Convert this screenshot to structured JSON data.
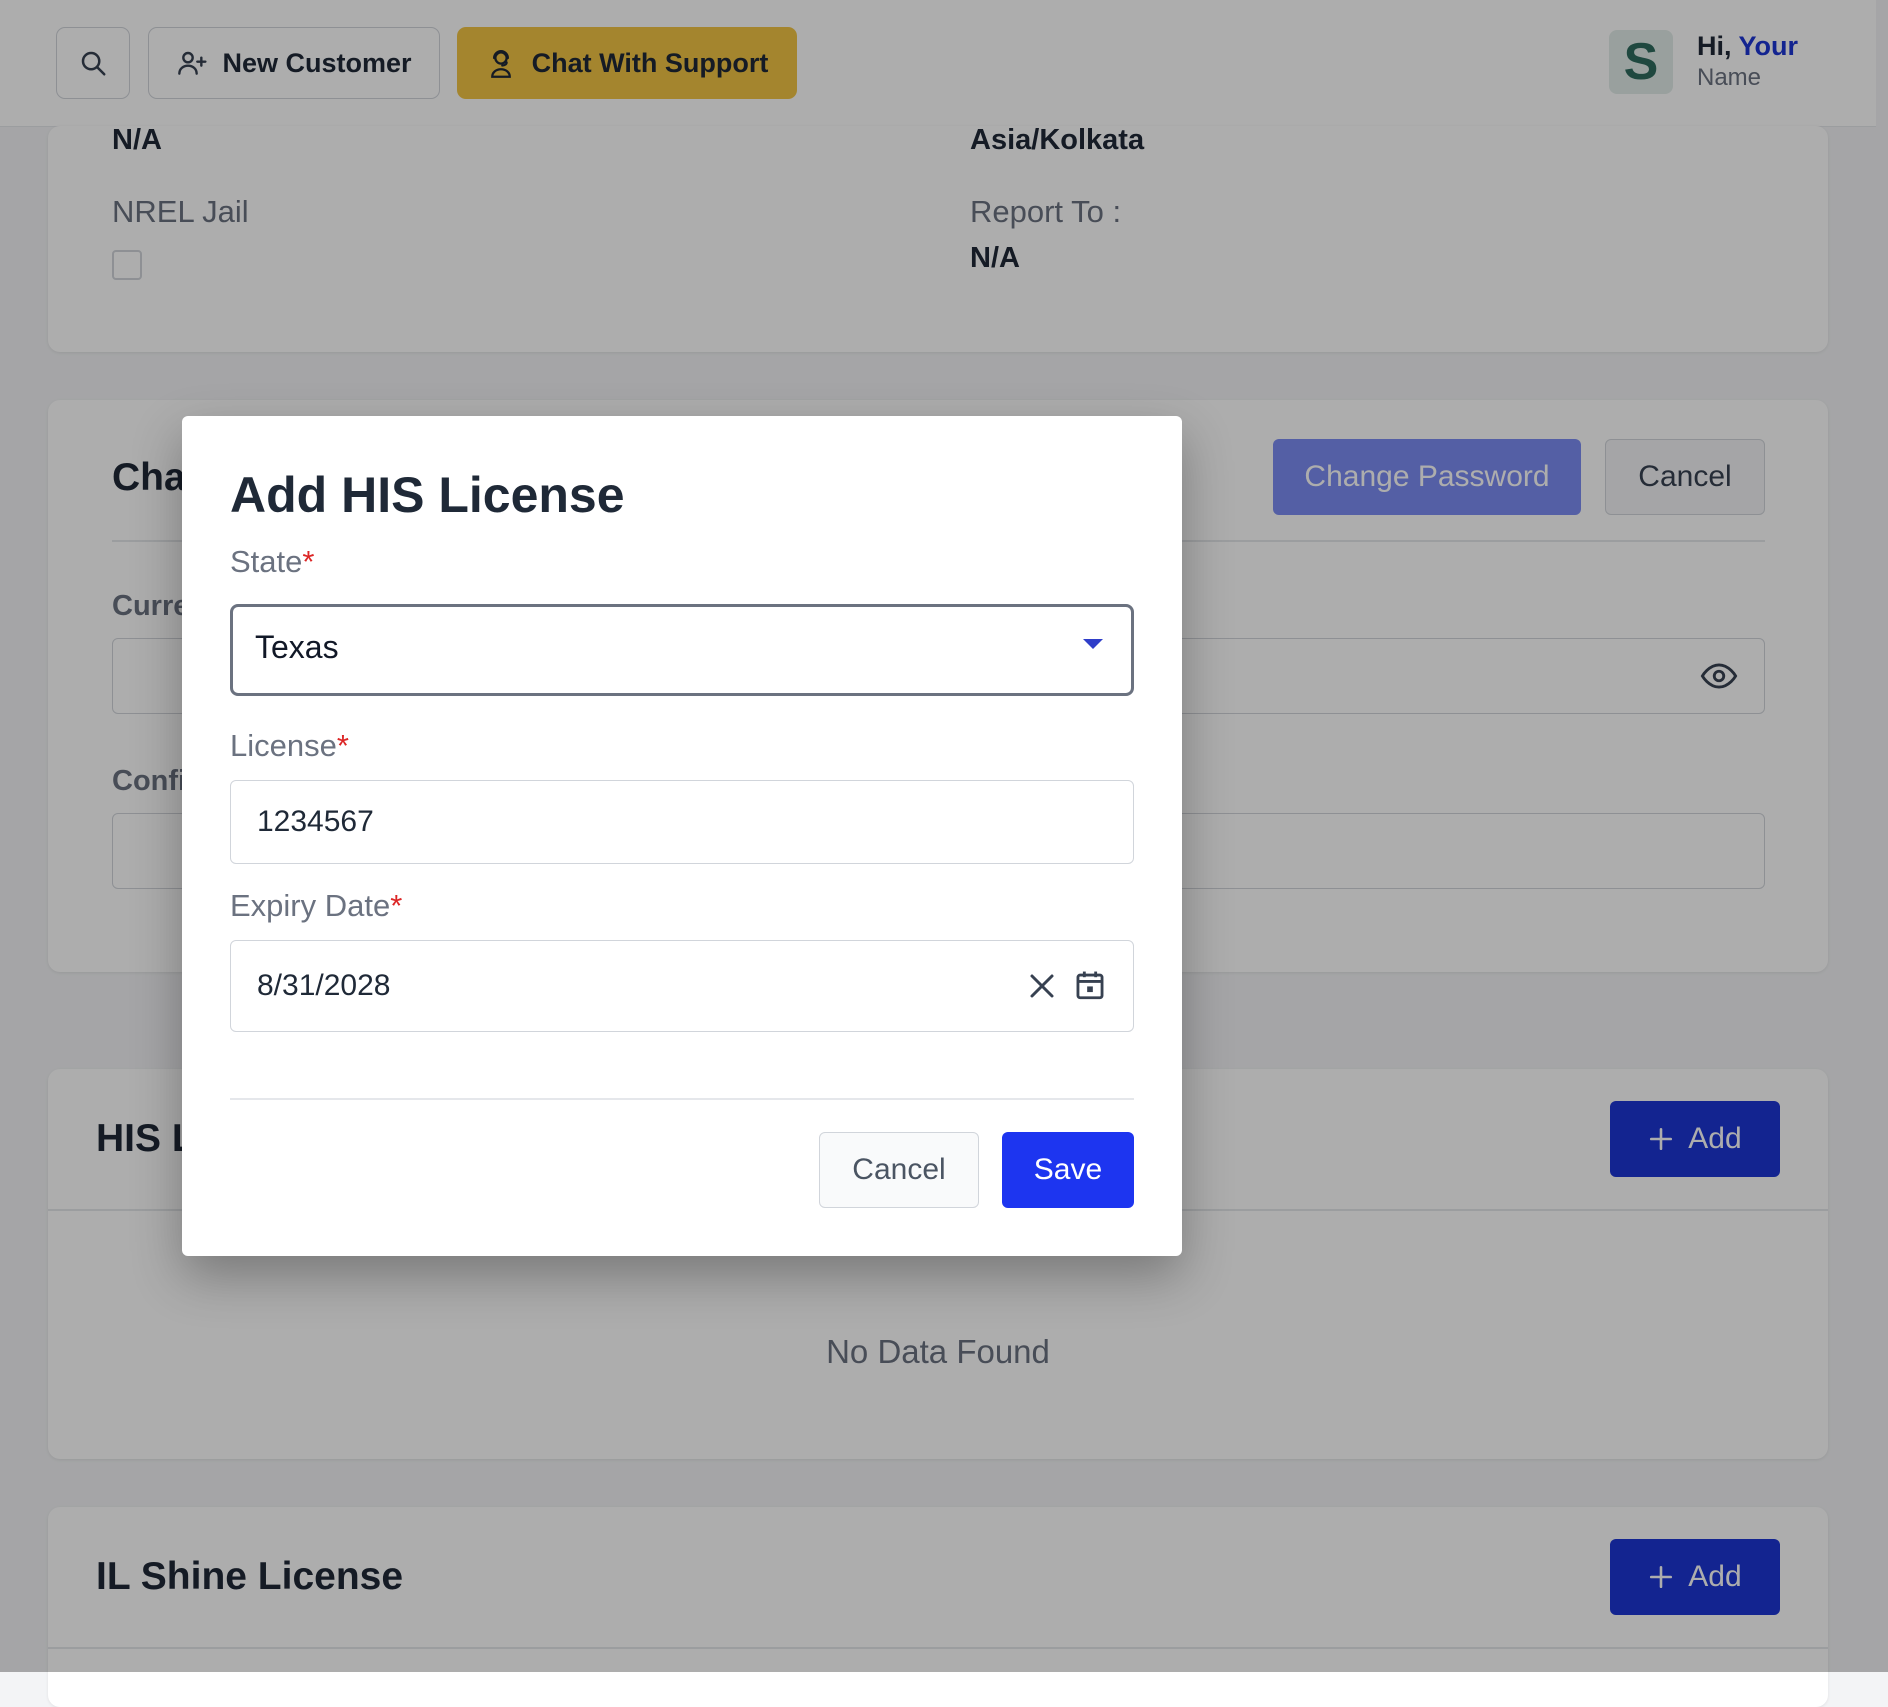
{
  "header": {
    "new_customer_label": "New Customer",
    "support_label": "Chat With Support",
    "avatar_letter": "S",
    "greeting_prefix": "Hi,",
    "greeting_name_first": "Your",
    "greeting_name_second": "Name"
  },
  "profile_card": {
    "left_value_top": "N/A",
    "right_value_top": "Asia/Kolkata",
    "nrel_label": "NREL Jail",
    "report_to_label": "Report To :",
    "report_to_value": "N/A"
  },
  "password_card": {
    "title_partial": "Cha",
    "change_password_label": "Change Password",
    "cancel_label": "Cancel",
    "current_label_partial": "Curre",
    "confirm_label_partial": "Confi"
  },
  "his_card": {
    "title_partial": "HIS L",
    "add_label": "Add",
    "empty_text": "No Data Found"
  },
  "il_card": {
    "title": "IL Shine License",
    "add_label": "Add"
  },
  "modal": {
    "title": "Add HIS License",
    "state_label": "State",
    "state_value": "Texas",
    "license_label": "License",
    "license_value": "1234567",
    "expiry_label": "Expiry Date",
    "expiry_value": "8/31/2028",
    "required_mark": "*",
    "cancel_label": "Cancel",
    "save_label": "Save"
  },
  "colors": {
    "support_button": "#f2c445",
    "primary": "#1d35d4",
    "save_button": "#1d35f0",
    "change_password_button": "#7c8cf4",
    "required": "#dc2626"
  },
  "icons": [
    "search-icon",
    "user-plus-icon",
    "support-agent-icon",
    "eye-icon",
    "plus-icon",
    "clear-icon",
    "calendar-icon",
    "dropdown-caret-icon"
  ]
}
